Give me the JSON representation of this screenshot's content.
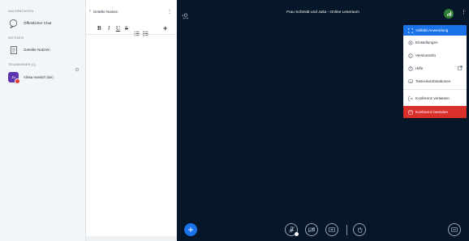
{
  "sidebar": {
    "messages_title": "NACHRICHTEN",
    "public_chat": "Öffentlicher Chat",
    "notes_title": "NOTIZEN",
    "shared_notes": "Geteilte Notizen",
    "participants_title": "TEILNEHMER (1)",
    "participant": {
      "initials": "Ju",
      "name": "Alissa Hanisch (sie)"
    }
  },
  "notes_panel": {
    "back_label": "Geteilte Notizen",
    "toolbar": {
      "bold": "B",
      "italic": "I",
      "underline": "U",
      "strike": "S"
    }
  },
  "header": {
    "title": "Frau Schmidt und Julia - Online Leseraum"
  },
  "menu": {
    "items": [
      {
        "label": "Vollbild-Anwendung",
        "icon": "fullscreen-icon"
      },
      {
        "label": "Einstellungen",
        "icon": "settings-icon"
      },
      {
        "label": "Versionsinfo",
        "icon": "info-icon"
      },
      {
        "label": "Hilfe",
        "icon": "help-icon"
      },
      {
        "label": "Tastenkombinationen",
        "icon": "keyboard-icon"
      },
      {
        "label": "Konferenz verlassen",
        "icon": "logout-icon"
      },
      {
        "label": "Konferenz beenden",
        "icon": "end-conference-icon"
      }
    ]
  },
  "colors": {
    "main_bg": "#06172a",
    "accent": "#1a73e8",
    "danger": "#d9302c",
    "green": "#2e7d32"
  }
}
